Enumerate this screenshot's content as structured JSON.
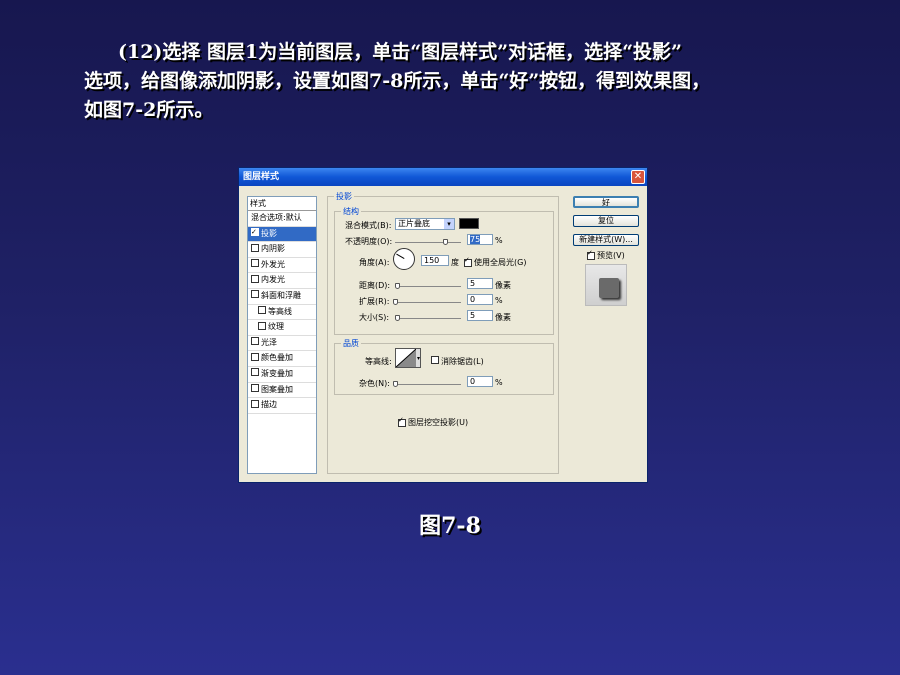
{
  "paragraph": {
    "line1": "(12)选择 图层1为当前图层，单击“图层样式”对话框，选择“投影”",
    "line2": "选项，给图像添加阴影，设置如图7-8所示，单击“好”按钮，得到效果图，",
    "line3": "如图7-2所示。"
  },
  "caption": "图7-8",
  "dialog": {
    "title": "图层样式",
    "close_icon": "close-icon",
    "style_list": {
      "header": "样式",
      "items": [
        {
          "label": "混合选项:默认",
          "checkbox": false
        },
        {
          "label": "投影",
          "checkbox": true,
          "checked": true,
          "selected": true
        },
        {
          "label": "内阴影",
          "checkbox": true,
          "checked": false
        },
        {
          "label": "外发光",
          "checkbox": true,
          "checked": false
        },
        {
          "label": "内发光",
          "checkbox": true,
          "checked": false
        },
        {
          "label": "斜面和浮雕",
          "checkbox": true,
          "checked": false
        },
        {
          "label": "等高线",
          "checkbox": true,
          "checked": false,
          "sub": true
        },
        {
          "label": "纹理",
          "checkbox": true,
          "checked": false,
          "sub": true
        },
        {
          "label": "光泽",
          "checkbox": true,
          "checked": false
        },
        {
          "label": "颜色叠加",
          "checkbox": true,
          "checked": false
        },
        {
          "label": "渐变叠加",
          "checkbox": true,
          "checked": false
        },
        {
          "label": "图案叠加",
          "checkbox": true,
          "checked": false
        },
        {
          "label": "描边",
          "checkbox": true,
          "checked": false
        }
      ]
    },
    "drop_shadow": {
      "section_title": "投影",
      "structure_title": "结构",
      "blend_mode_label": "混合模式(B):",
      "blend_mode_value": "正片叠底",
      "shadow_color": "#000000",
      "opacity_label": "不透明度(O):",
      "opacity_value": "75",
      "opacity_unit": "%",
      "angle_label": "角度(A):",
      "angle_value": "150",
      "angle_unit": "度",
      "global_light_label": "使用全局光(G)",
      "global_light_checked": true,
      "distance_label": "距离(D):",
      "distance_value": "5",
      "distance_unit": "像素",
      "spread_label": "扩展(R):",
      "spread_value": "0",
      "spread_unit": "%",
      "size_label": "大小(S):",
      "size_value": "5",
      "size_unit": "像素",
      "quality_title": "品质",
      "contour_label": "等高线:",
      "antialias_label": "消除锯齿(L)",
      "antialias_checked": false,
      "noise_label": "杂色(N):",
      "noise_value": "0",
      "noise_unit": "%",
      "knockout_label": "图层挖空投影(U)",
      "knockout_checked": true
    },
    "buttons": {
      "ok": "好",
      "reset": "复位",
      "new_style": "新建样式(W)...",
      "preview_label": "预览(V)",
      "preview_checked": true
    }
  }
}
